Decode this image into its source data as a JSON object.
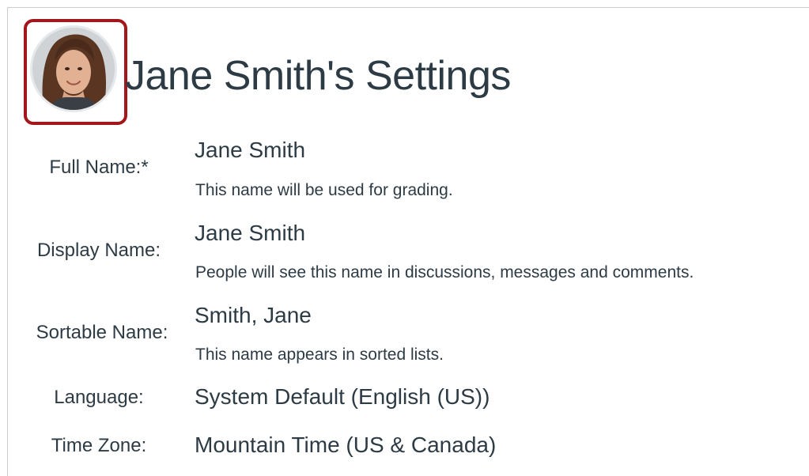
{
  "page": {
    "title": "Jane Smith's Settings"
  },
  "profile": {
    "avatar_alt": "Profile picture",
    "highlight_color": "#a3161b"
  },
  "fields": {
    "full_name": {
      "label": "Full Name:*",
      "value": "Jane Smith",
      "hint": "This name will be used for grading."
    },
    "display_name": {
      "label": "Display Name:",
      "value": "Jane Smith",
      "hint": "People will see this name in discussions, messages and comments."
    },
    "sortable_name": {
      "label": "Sortable Name:",
      "value": "Smith, Jane",
      "hint": "This name appears in sorted lists."
    },
    "language": {
      "label": "Language:",
      "value": "System Default (English (US))"
    },
    "time_zone": {
      "label": "Time Zone:",
      "value": "Mountain Time (US & Canada)"
    }
  },
  "colors": {
    "text": "#2d3b45",
    "border": "#c7cdd1",
    "avatar_highlight": "#a3161b"
  }
}
